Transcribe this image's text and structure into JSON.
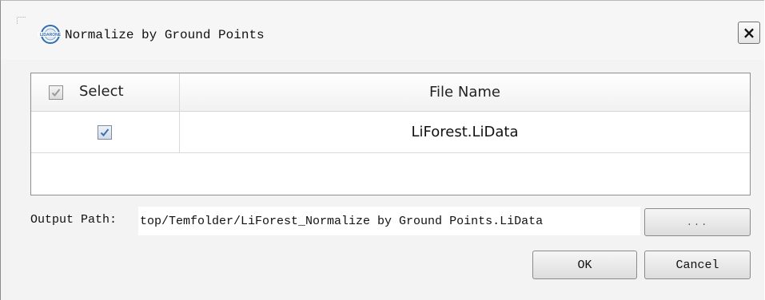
{
  "window": {
    "title": "Normalize by Ground Points",
    "logo_text": "LIDARONE",
    "close_label": "×"
  },
  "table": {
    "columns": [
      "Select",
      "File Name"
    ],
    "header_checkbox_checked": true,
    "rows": [
      {
        "checked": true,
        "file_name": "LiForest.LiData"
      }
    ]
  },
  "output": {
    "label": "Output Path:",
    "value": "top/Temfolder/LiForest_Normalize by Ground Points.LiData",
    "browse_label": "..."
  },
  "buttons": {
    "ok_label": "OK",
    "cancel_label": "Cancel"
  },
  "colors": {
    "window_bg": "#f3f3f3",
    "table_bg": "#ffffff",
    "checkmark": "#3a6fb0",
    "logo_blue": "#2f6db5"
  }
}
